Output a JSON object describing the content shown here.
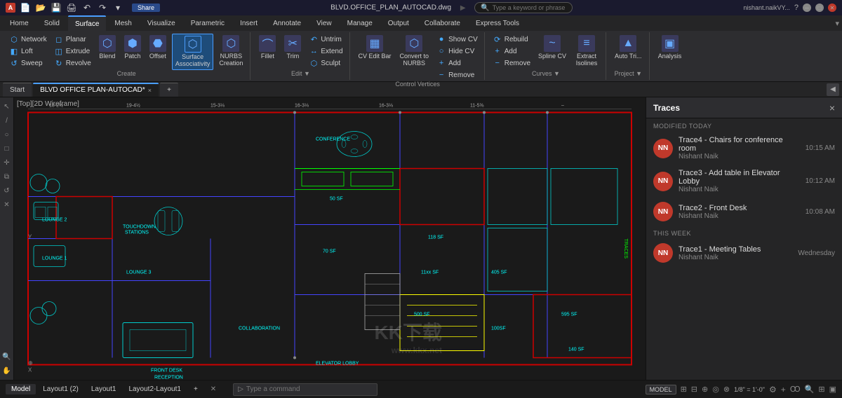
{
  "titlebar": {
    "app": "A CAD",
    "filename": "BLVD.OFFICE_PLAN_AUTOCAD.dwg",
    "search_placeholder": "Type a keyword or phrase",
    "user": "nishant.naikVY...",
    "share": "Share"
  },
  "ribbon": {
    "tabs": [
      "Home",
      "Solid",
      "Surface",
      "Mesh",
      "Visualize",
      "Parametric",
      "Insert",
      "Annotate",
      "View",
      "Manage",
      "Output",
      "Collaborate",
      "Express Tools"
    ],
    "active_tab": "Surface",
    "groups": [
      {
        "label": "Create",
        "items": [
          {
            "label": "Network",
            "icon": "⬡",
            "type": "small"
          },
          {
            "label": "Planar",
            "icon": "◻",
            "type": "small"
          },
          {
            "label": "Extrude",
            "icon": "◫",
            "type": "small"
          },
          {
            "label": "Loft",
            "icon": "◧",
            "type": "small"
          },
          {
            "label": "Sweep",
            "icon": "↺",
            "type": "small"
          },
          {
            "label": "Revolve",
            "icon": "↻",
            "type": "small"
          },
          {
            "label": "Blend",
            "icon": "⬡",
            "type": "large"
          },
          {
            "label": "Patch",
            "icon": "⬢",
            "type": "large"
          },
          {
            "label": "Offset",
            "icon": "⬣",
            "type": "large"
          },
          {
            "label": "Surface\nAssociativity",
            "icon": "⬡",
            "type": "large",
            "active": true
          },
          {
            "label": "NURBS\nCreation",
            "icon": "⬡",
            "type": "large"
          }
        ]
      },
      {
        "label": "Edit ▼",
        "items": [
          {
            "label": "Fillet",
            "icon": "⌒",
            "type": "large"
          },
          {
            "label": "Trim",
            "icon": "✂",
            "type": "large"
          },
          {
            "label": "Untrim",
            "icon": "↶",
            "type": "small"
          },
          {
            "label": "Extend",
            "icon": "↔",
            "type": "small"
          },
          {
            "label": "Sculpt",
            "icon": "⬡",
            "type": "small"
          }
        ]
      },
      {
        "label": "Control Vertices",
        "items": [
          {
            "label": "CV Edit Bar",
            "icon": "▦",
            "type": "large"
          },
          {
            "label": "Convert to NURBS",
            "icon": "⬡",
            "type": "large"
          },
          {
            "label": "Show CV",
            "icon": "●",
            "type": "small"
          },
          {
            "label": "Hide CV",
            "icon": "○",
            "type": "small"
          },
          {
            "label": "Add",
            "icon": "+",
            "type": "small"
          },
          {
            "label": "Remove",
            "icon": "−",
            "type": "small"
          }
        ]
      },
      {
        "label": "Curves ▼",
        "items": [
          {
            "label": "Rebuild",
            "icon": "⟳",
            "type": "small"
          },
          {
            "label": "Add",
            "icon": "+",
            "type": "small"
          },
          {
            "label": "Remove",
            "icon": "−",
            "type": "small"
          },
          {
            "label": "Spline CV",
            "icon": "~",
            "type": "large"
          },
          {
            "label": "Extract\nIsolines",
            "icon": "≡",
            "type": "large"
          }
        ]
      },
      {
        "label": "Project ▼",
        "items": [
          {
            "label": "Auto Tri...",
            "icon": "▲",
            "type": "large"
          }
        ]
      },
      {
        "label": "",
        "items": [
          {
            "label": "Analysis",
            "icon": "▣",
            "type": "large"
          }
        ]
      }
    ]
  },
  "document": {
    "tabs": [
      {
        "label": "Start",
        "active": false
      },
      {
        "label": "BLVD OFFICE PLAN-AUTOCAD*",
        "active": true
      },
      {
        "label": "+",
        "active": false
      }
    ],
    "viewport_label": "[Top][2D Wireframe]"
  },
  "traces_panel": {
    "title": "Traces",
    "close_label": "×",
    "section_today": "MODIFIED TODAY",
    "section_week": "THIS WEEK",
    "items": [
      {
        "id": 1,
        "name": "Trace4 - Chairs for conference room",
        "author": "Nishant Naik",
        "time": "10:15 AM",
        "avatar_initials": "NN",
        "section": "today"
      },
      {
        "id": 2,
        "name": "Trace3 - Add table in Elevator Lobby",
        "author": "Nishant Naik",
        "time": "10:12 AM",
        "avatar_initials": "NN",
        "section": "today"
      },
      {
        "id": 3,
        "name": "Trace2 - Front Desk",
        "author": "Nishant Naik",
        "time": "10:08 AM",
        "avatar_initials": "NN",
        "section": "today"
      },
      {
        "id": 4,
        "name": "Trace1 - Meeting Tables",
        "author": "Nishant Naik",
        "time": "Wednesday",
        "avatar_initials": "NN",
        "section": "week"
      }
    ]
  },
  "statusbar": {
    "tabs": [
      "Model",
      "Layout1 (2)",
      "Layout1",
      "Layout2-Layout1"
    ],
    "active_tab": "Model",
    "command_placeholder": "Type a command",
    "model_label": "MODEL",
    "scale": "1/8\" = 1'-0\"",
    "add_tab": "+"
  },
  "watermark": {
    "text": "KK下载",
    "subtitle": "www.kkx.net"
  }
}
